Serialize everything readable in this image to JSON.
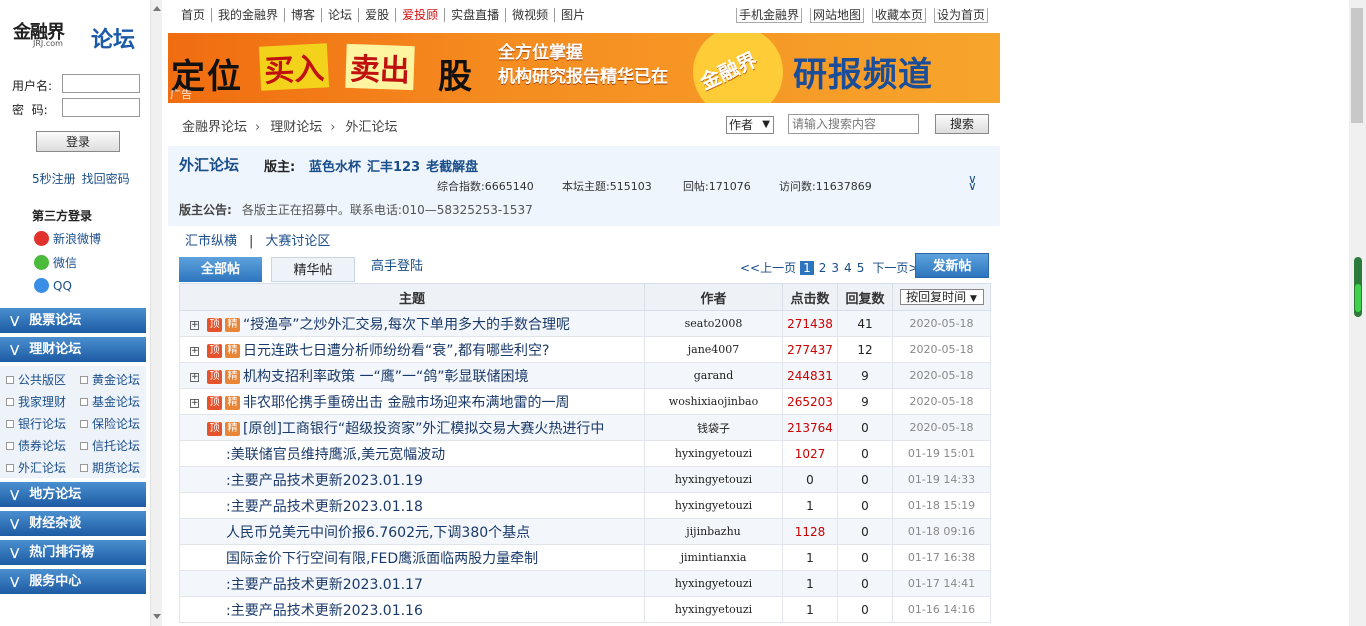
{
  "logo": {
    "brand": "金融界",
    "domain": "JRJ.com",
    "forum": "论坛"
  },
  "login": {
    "username_label": "用户名:",
    "password_label": "密  码:",
    "username_value": "",
    "password_value": "",
    "login_button": "登录",
    "register": "5秒注册",
    "recover": "找回密码"
  },
  "third_party": {
    "title": "第三方登录",
    "weibo": "新浪微博",
    "wechat": "微信",
    "qq": "QQ"
  },
  "sidebar_sections": {
    "stock": "股票论坛",
    "finance": "理财论坛",
    "local": "地方论坛",
    "misc": "财经杂谈",
    "rank": "热门排行榜",
    "service": "服务中心"
  },
  "finance_sub": [
    "公共版区",
    "黄金论坛",
    "我家理财",
    "基金论坛",
    "银行论坛",
    "保险论坛",
    "债券论坛",
    "信托论坛",
    "外汇论坛",
    "期货论坛"
  ],
  "topnav": {
    "left": [
      "首页",
      "我的金融界",
      "博客",
      "论坛",
      "爱股",
      "爱投顾",
      "实盘直播",
      "微视频",
      "图片"
    ],
    "right": [
      "手机金融界",
      "网站地图",
      "收藏本页",
      "设为首页"
    ]
  },
  "banner": {
    "t1": "定位",
    "t2": "买入",
    "t3": "卖出",
    "t4": "股",
    "mid1": "全方位掌握",
    "mid2": "机构研究报告精华已在",
    "brand": "金融界",
    "channel": "研报频道",
    "ad": "广告"
  },
  "breadcrumb": [
    "金融界论坛",
    "理财论坛",
    "外汇论坛"
  ],
  "search": {
    "filter": "作者",
    "placeholder": "请输入搜索内容",
    "button": "搜索"
  },
  "forum": {
    "name": "外汇论坛",
    "mod_label": "版主:",
    "moderators": [
      "蓝色水杯",
      "汇丰123",
      "老截解盘"
    ],
    "stats": {
      "total": "综合指数:6665140",
      "topics": "本坛主题:515103",
      "replies": "回帖:171076",
      "visits": "访问数:11637869"
    },
    "announce_label": "版主公告:",
    "announce": "各版主正在招募中。联系电话:010—58325253-1537"
  },
  "subnav": {
    "a": "汇市纵横",
    "sep": "|",
    "b": "大赛讨论区"
  },
  "tabs": {
    "all": "全部帖",
    "best": "精华帖",
    "expert": "高手登陆"
  },
  "pager": {
    "prev": "<<上一页",
    "pages": [
      "1",
      "2",
      "3",
      "4",
      "5"
    ],
    "next": "下一页>>",
    "new_post": "发新帖"
  },
  "table": {
    "headers": {
      "title": "主题",
      "author": "作者",
      "clicks": "点击数",
      "replies": "回复数",
      "sort": "按回复时间"
    },
    "rows": [
      {
        "title": "“授渔亭”之炒外汇交易,每次下单用多大的手数合理呢",
        "author": "seato2008",
        "clicks": "271438",
        "replies": "41",
        "date": "2020-05-18",
        "ding": "顶",
        "jing": "精",
        "expand": "+"
      },
      {
        "title": "日元连跌七日遭分析师纷纷看“衰”,都有哪些利空?",
        "author": "jane4007",
        "clicks": "277437",
        "replies": "12",
        "date": "2020-05-18",
        "ding": "顶",
        "jing": "精",
        "expand": "+"
      },
      {
        "title": "机构支招利率政策 一“鹰”一“鸽”彰显联储困境",
        "author": "garand",
        "clicks": "244831",
        "replies": "9",
        "date": "2020-05-18",
        "ding": "顶",
        "jing": "精",
        "expand": "+"
      },
      {
        "title": "非农耶伦携手重磅出击 金融市场迎来布满地雷的一周",
        "author": "woshixiaojinbao",
        "clicks": "265203",
        "replies": "9",
        "date": "2020-05-18",
        "ding": "顶",
        "jing": "精",
        "expand": "+"
      },
      {
        "title": "[原创]工商银行“超级投资家”外汇模拟交易大赛火热进行中",
        "author": "钱袋子",
        "clicks": "213764",
        "replies": "0",
        "date": "2020-05-18",
        "ding": "顶",
        "jing": "精",
        "expand": ""
      },
      {
        "title": ":美联储官员维持鹰派,美元宽幅波动",
        "author": "hyxingyetouzi",
        "clicks": "1027",
        "replies": "0",
        "date": "01-19 15:01",
        "ding": "",
        "jing": "",
        "expand": ""
      },
      {
        "title": ":主要产品技术更新2023.01.19",
        "author": "hyxingyetouzi",
        "clicks": "0",
        "replies": "0",
        "date": "01-19 14:33",
        "ding": "",
        "jing": "",
        "expand": ""
      },
      {
        "title": ":主要产品技术更新2023.01.18",
        "author": "hyxingyetouzi",
        "clicks": "1",
        "replies": "0",
        "date": "01-18 15:19",
        "ding": "",
        "jing": "",
        "expand": ""
      },
      {
        "title": "人民币兑美元中间价报6.7602元,下调380个基点",
        "author": "jijinbazhu",
        "clicks": "1128",
        "replies": "0",
        "date": "01-18 09:16",
        "ding": "",
        "jing": "",
        "expand": ""
      },
      {
        "title": "国际金价下行空间有限,FED鹰派面临两股力量牵制",
        "author": "jimintianxia",
        "clicks": "1",
        "replies": "0",
        "date": "01-17 16:38",
        "ding": "",
        "jing": "",
        "expand": ""
      },
      {
        "title": ":主要产品技术更新2023.01.17",
        "author": "hyxingyetouzi",
        "clicks": "1",
        "replies": "0",
        "date": "01-17 14:41",
        "ding": "",
        "jing": "",
        "expand": ""
      },
      {
        "title": ":主要产品技术更新2023.01.16",
        "author": "hyxingyetouzi",
        "clicks": "1",
        "replies": "0",
        "date": "01-16 14:16",
        "ding": "",
        "jing": "",
        "expand": ""
      }
    ]
  }
}
